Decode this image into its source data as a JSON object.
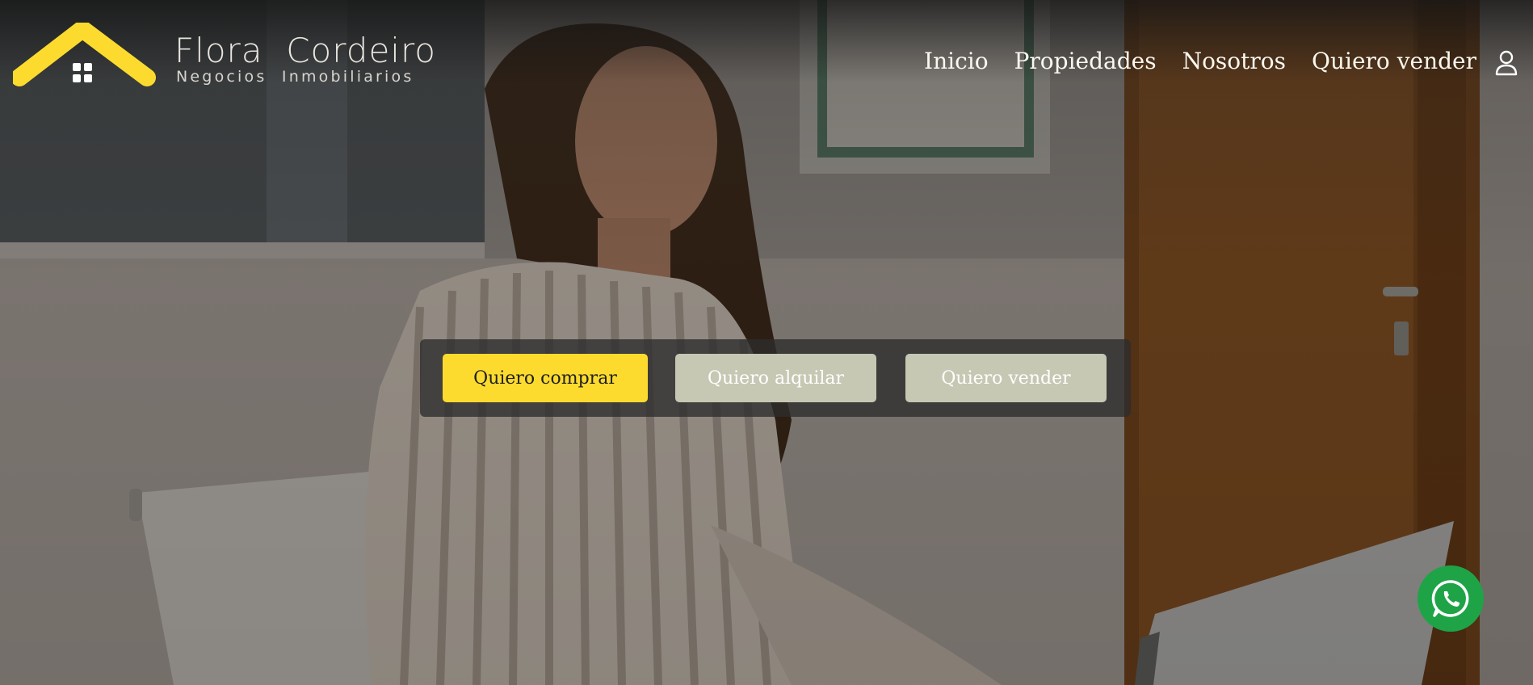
{
  "brand": {
    "name": "Flora  Cordeiro",
    "subtitle": "Negocios  Inmobiliarios"
  },
  "nav": {
    "items": [
      "Inicio",
      "Propiedades",
      "Nosotros",
      "Quiero vender"
    ]
  },
  "search_panel": {
    "buy_label": "Quiero comprar",
    "rent_label": "Quiero alquilar",
    "sell_label": "Quiero vender"
  },
  "icons": {
    "user": "user-icon",
    "whatsapp": "whatsapp-icon",
    "logo": "house-roof-icon"
  },
  "colors": {
    "accent": "#fddb2e",
    "secondary_button": "#c6c8b3",
    "whatsapp": "#1fa347",
    "header_dark": "#1b1b1b"
  }
}
